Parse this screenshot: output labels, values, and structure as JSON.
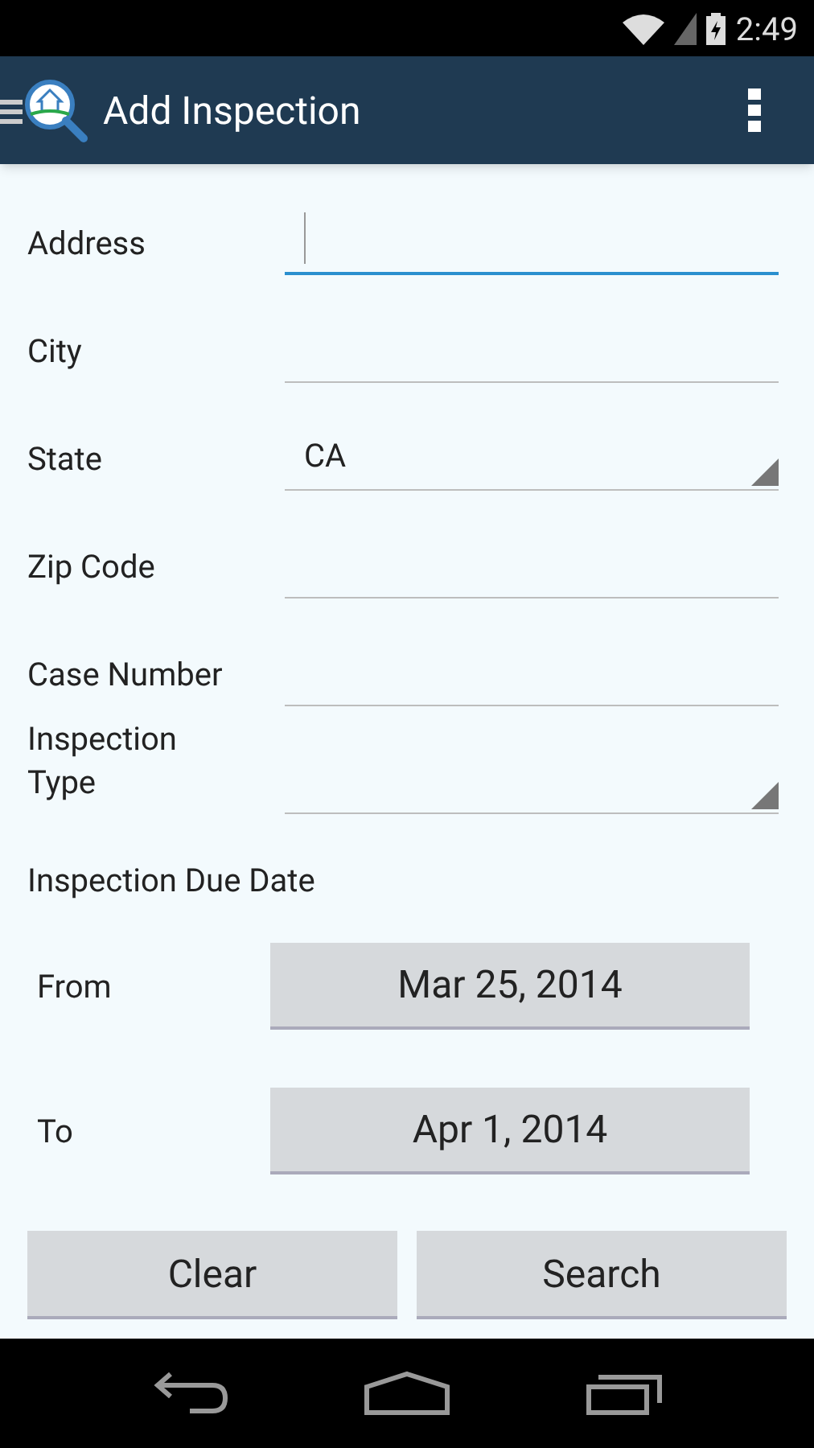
{
  "status_bar": {
    "time": "2:49"
  },
  "app_bar": {
    "title": "Add Inspection"
  },
  "fields": [
    {
      "label": "Address",
      "kind": "text",
      "focused": true
    },
    {
      "label": "City",
      "kind": "text",
      "focused": false
    },
    {
      "label": "State",
      "kind": "spinner",
      "value": "CA",
      "focused": false
    },
    {
      "label": "Zip Code",
      "kind": "text",
      "focused": false
    },
    {
      "label": "Case Number",
      "kind": "text",
      "focused": false
    },
    {
      "label": "Inspection Type",
      "kind": "spinner",
      "focused": false
    }
  ],
  "due_date": {
    "heading": "Inspection Due Date",
    "rows": [
      {
        "label": "From",
        "value": "Mar 25, 2014"
      },
      {
        "label": "To",
        "value": "Apr 1, 2014"
      }
    ]
  },
  "buttons": [
    "Clear",
    "Search"
  ]
}
